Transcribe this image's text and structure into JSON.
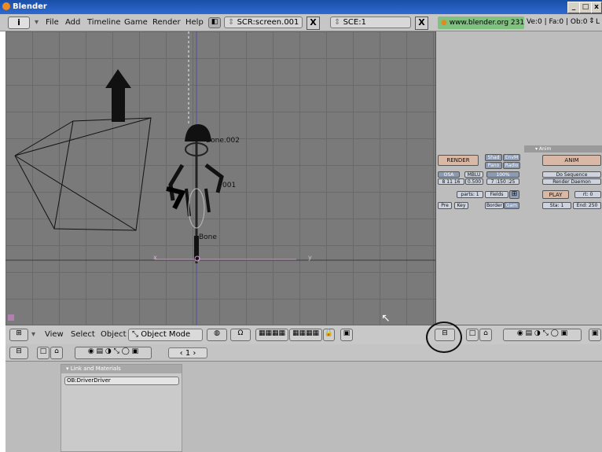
{
  "window": {
    "title": "Blender",
    "controls": [
      "_",
      "□",
      "x"
    ]
  },
  "menubar": {
    "menu_items": [
      "File",
      "Add",
      "Timeline",
      "Game",
      "Render",
      "Help"
    ],
    "screen_field": "SCR:screen.001",
    "scene_field": "SCE:1",
    "close_glyph": "X",
    "info_link": "www.blender.org 231",
    "stats": "Ve:0 | Fa:0 | Ob:0",
    "stats_tail": "L"
  },
  "viewport": {
    "labels": {
      "bone_002": "Bone.002",
      "bone_001": "001",
      "bone": "Bone",
      "axis_x": "x",
      "axis_y": "y"
    }
  },
  "render_panel": {
    "anim_header": "Anim",
    "render_button": "RENDER",
    "shad_button": "Shad",
    "envmap_button": "EnvM",
    "pano_button": "Pano",
    "radio_button": "Radio",
    "osa_button": "OSA",
    "mblur_button": "MBLU",
    "osa_value": "8 11 16",
    "bf_value": "0.500",
    "size_button": "100%",
    "ratio_value": "7 :150 :25",
    "parts_value": "parts: 1",
    "fields_button": "Fields",
    "pre_button": "Pre",
    "key_button": "Key",
    "border_button": "Border",
    "gamma_button": "Gam",
    "anim_button": "ANIM",
    "do_sequence": "Do Sequence",
    "render_daemon": "Render Daemon",
    "play_button": "PLAY",
    "rt_value": "rt: 0",
    "sta_value": "Sta: 1",
    "end_value": "End: 250"
  },
  "viewport_header": {
    "view_menu": "View",
    "select_menu": "Select",
    "object_menu": "Object",
    "mode_select": "Object Mode"
  },
  "buttons_header": {
    "frame_value": "1"
  },
  "link_materials": {
    "panel_title": "Link and Materials",
    "object_name": "OB:DriverDriver"
  }
}
